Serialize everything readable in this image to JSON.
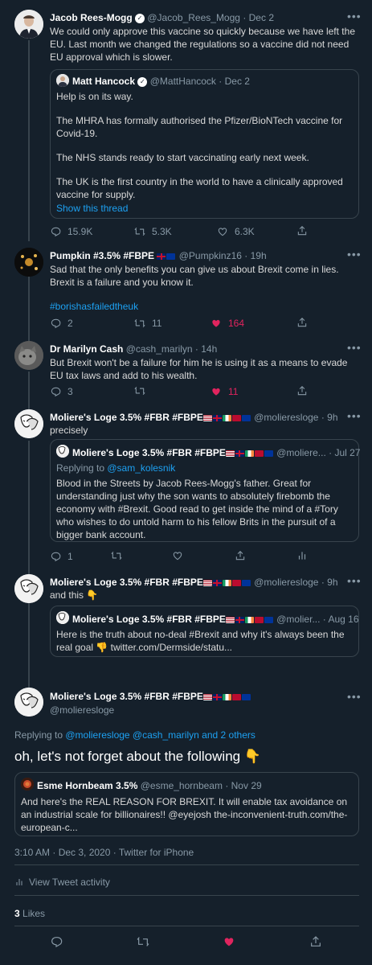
{
  "tweets": [
    {
      "name": "Jacob Rees-Mogg",
      "handle": "@Jacob_Rees_Mogg",
      "date": "· Dec 2",
      "text": "We could only approve this vaccine so quickly because we have left the EU. Last month we changed the regulations so a vaccine did not need EU approval which is slower.",
      "quote": {
        "name": "Matt Hancock",
        "handle": "@MattHancock",
        "date": "· Dec 2",
        "lines": [
          "Help is on its way.",
          "The MHRA has formally authorised the Pfizer/BioNTech vaccine for Covid-19.",
          "The NHS stands ready to start vaccinating early next week.",
          "The UK is the first country in the world to have a clinically approved vaccine for supply."
        ],
        "show_thread": "Show this thread"
      },
      "replies": "15.9K",
      "retweets": "5.3K",
      "likes": "6.3K"
    },
    {
      "name": "Pumpkin #3.5% #FBPE",
      "handle": "@Pumpkinz16",
      "date": "· 19h",
      "text": "Sad that the only benefits you can give us about Brexit come in lies.  Brexit is a failure and you know it.",
      "hashtag": "#borishasfailedtheuk",
      "replies": "2",
      "retweets": "11",
      "likes": "164"
    },
    {
      "name": "Dr Marilyn Cash",
      "handle": "@cash_marilyn",
      "date": "· 14h",
      "text": "But Brexit won't be a failure for him he is using it as a means to evade EU tax laws and add to his wealth.",
      "replies": "3",
      "retweets": "",
      "likes": "11"
    },
    {
      "name": "Moliere's Loge 3.5% #FBR #FBPE",
      "handle": "@molieresloge",
      "date": "· 9h",
      "text": "precisely",
      "quote": {
        "name": "Moliere's Loge 3.5% #FBR #FBPE",
        "handle": "@moliere...",
        "date": "· Jul 27",
        "replying": "Replying to ",
        "replying_handle": "@sam_kolesnik",
        "text": "Blood in the Streets by Jacob Rees-Mogg's father. Great for understanding just why the son wants to absolutely firebomb the economy with #Brexit. Good read to get inside the mind of a #Tory who wishes to do untold harm to his fellow Brits in the pursuit of a bigger bank account."
      },
      "replies": "1"
    },
    {
      "name": "Moliere's Loge 3.5% #FBR #FBPE",
      "handle": "@molieresloge",
      "date": "· 9h",
      "text": "and this 👇",
      "quote": {
        "name": "Moliere's Loge 3.5% #FBR #FBPE",
        "handle": "@molier...",
        "date": "· Aug 16",
        "text": "Here is the truth about no-deal #Brexit and why it's always been the real goal 👎 twitter.com/Dermside/statu..."
      }
    },
    {
      "name": "Moliere's Loge 3.5% #FBR #FBPE",
      "handle": "@molieresloge",
      "replying_to": "Replying to ",
      "replying_handles": "@molieresloge @cash_marilyn",
      "replying_and": " and ",
      "replying_others": "2 others",
      "text": "oh, let's not forget about the following 👇",
      "quote": {
        "name": "Esme Hornbeam 3.5%",
        "handle": "@esme_hornbeam",
        "date": "· Nov 29",
        "text": "And here's the REAL REASON FOR BREXIT.  It will enable tax avoidance on an industrial scale for billionaires!! @eyejosh the-inconvenient-truth.com/the-european-c..."
      },
      "timestamp": "3:10 AM · Dec 3, 2020 · Twitter for iPhone",
      "activity": "View Tweet activity",
      "like_count": "3",
      "likes_label": "Likes"
    }
  ],
  "colors": {
    "bg": "#15202b",
    "border": "#38444d",
    "accent": "#1da1f2",
    "like": "#e0245e"
  }
}
